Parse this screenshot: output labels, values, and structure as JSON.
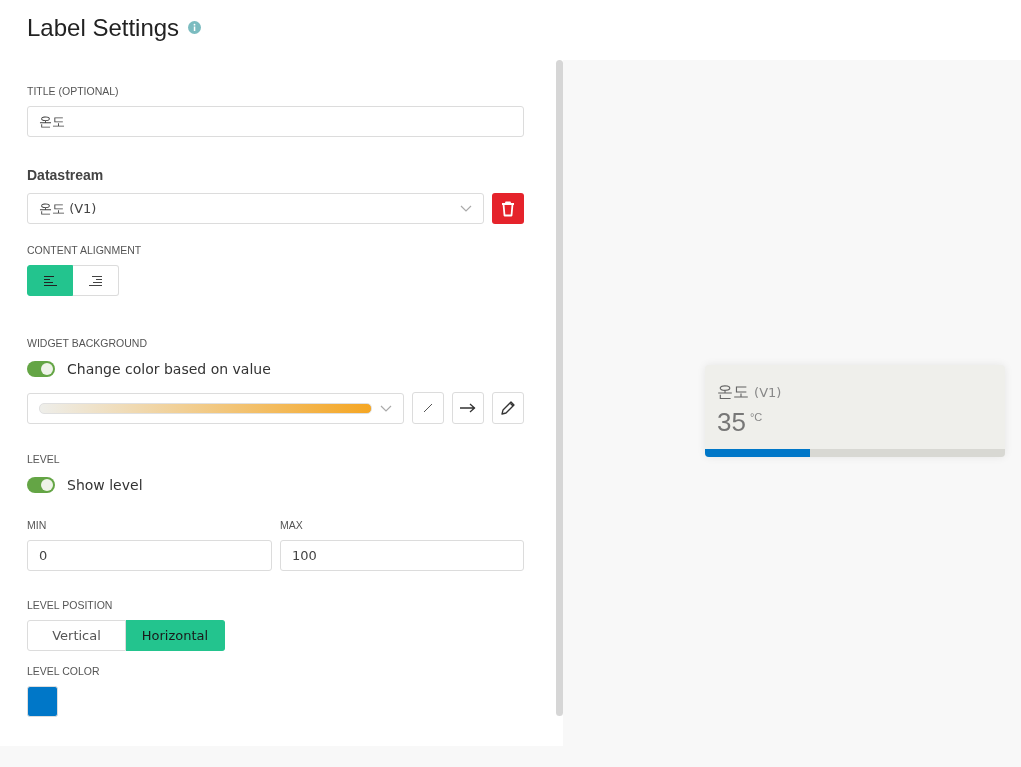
{
  "header": {
    "title": "Label Settings"
  },
  "title_field": {
    "label": "TITLE (OPTIONAL)",
    "value": "온도"
  },
  "datastream": {
    "label": "Datastream",
    "value": "온도 (V1)"
  },
  "alignment": {
    "label": "CONTENT ALIGNMENT",
    "options": [
      {
        "kind": "left",
        "selected": true
      },
      {
        "kind": "right",
        "selected": false
      }
    ]
  },
  "background": {
    "label": "WIDGET BACKGROUND",
    "toggle": {
      "label": "Change color based on value",
      "on": true
    }
  },
  "level": {
    "label": "LEVEL",
    "toggle": {
      "label": "Show level",
      "on": true
    },
    "min": {
      "label": "MIN",
      "value": "0"
    },
    "max": {
      "label": "MAX",
      "value": "100"
    }
  },
  "level_position": {
    "label": "LEVEL POSITION",
    "options": [
      {
        "label": "Vertical",
        "selected": false
      },
      {
        "label": "Horizontal",
        "selected": true
      }
    ]
  },
  "level_color": {
    "label": "LEVEL COLOR",
    "color": "#0077c8"
  },
  "preview": {
    "title": "온도",
    "stream": "(V1)",
    "value": "35",
    "unit": "°C",
    "level": 0.35
  }
}
